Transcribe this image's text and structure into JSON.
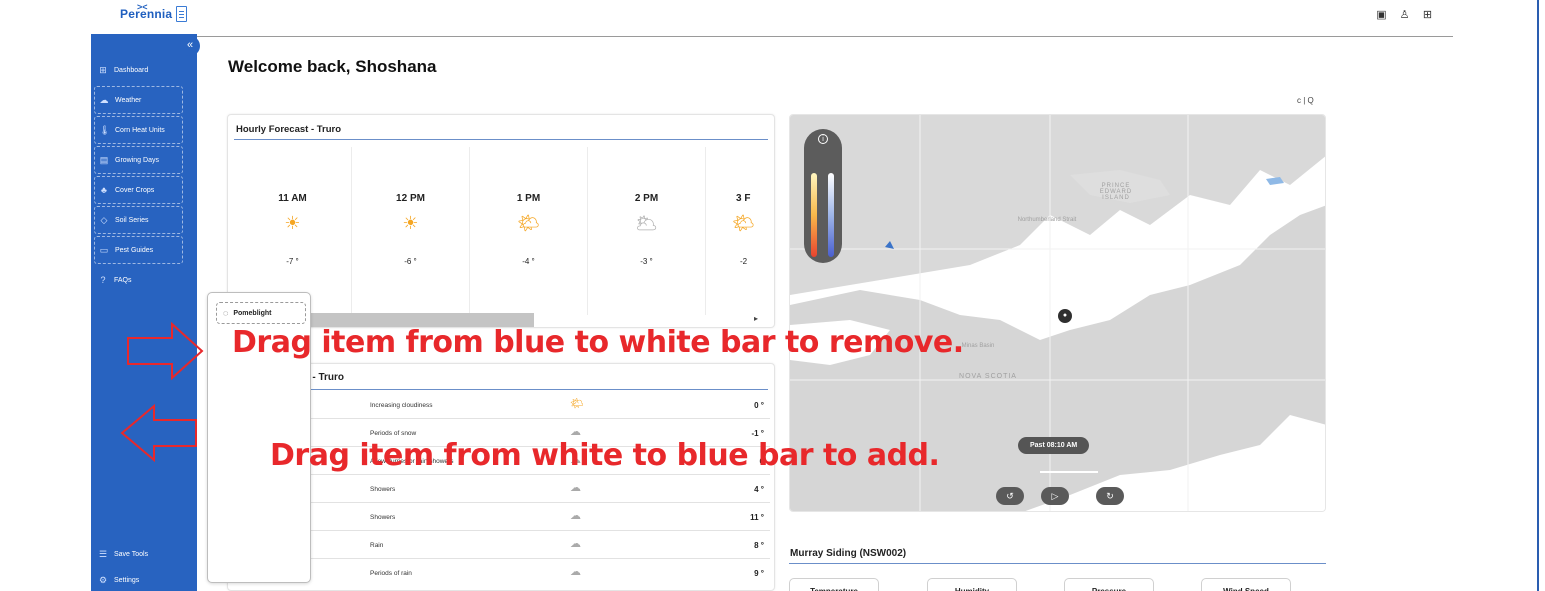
{
  "app": {
    "logo_text": "Perennia",
    "logo_mark": "><"
  },
  "header": {
    "icons": [
      "clipboard-icon",
      "user-icon",
      "grid-icon"
    ]
  },
  "sidebar": {
    "collapse_label": "«",
    "items": [
      {
        "label": "Dashboard",
        "icon": "dashboard-icon"
      },
      {
        "label": "Weather",
        "icon": "weather-icon"
      },
      {
        "label": "Corn Heat Units",
        "icon": "thermometer-icon"
      },
      {
        "label": "Growing Days",
        "icon": "calendar-icon"
      },
      {
        "label": "Cover Crops",
        "icon": "plant-icon"
      },
      {
        "label": "Soil Series",
        "icon": "soil-icon"
      },
      {
        "label": "Pest Guides",
        "icon": "book-icon"
      },
      {
        "label": "FAQs",
        "icon": "help-icon"
      }
    ],
    "bottom_items": [
      {
        "label": "Save Tools",
        "icon": "list-icon"
      },
      {
        "label": "Settings",
        "icon": "gear-icon"
      }
    ]
  },
  "main": {
    "welcome": "Welcome back, Shoshana",
    "map_tools": "c | Q"
  },
  "hourly": {
    "title": "Hourly Forecast - Truro",
    "hours": [
      {
        "time": "11 AM",
        "icon": "☀",
        "temp": "-7 °"
      },
      {
        "time": "12 PM",
        "icon": "☀",
        "temp": "-6 °"
      },
      {
        "time": "1 PM",
        "icon": "🌤",
        "temp": "-4 °"
      },
      {
        "time": "2 PM",
        "icon": "🌥",
        "temp": "-3 °"
      },
      {
        "time": "3 F",
        "icon": "🌤",
        "temp": "-2"
      }
    ],
    "scroll_arrow": "▸"
  },
  "daily": {
    "title": "ecast - Truro",
    "rows": [
      {
        "desc": "Increasing cloudiness",
        "icon": "🌤",
        "temp": "0 °"
      },
      {
        "desc": "Periods of snow",
        "icon": "☁",
        "temp": "-1 °"
      },
      {
        "desc": "A few flurries or rain showers",
        "icon": "☁",
        "temp": "6"
      },
      {
        "desc": "Showers",
        "icon": "☁",
        "temp": "4 °"
      },
      {
        "desc": "Showers",
        "icon": "☁",
        "temp": "11 °"
      },
      {
        "desc": "Rain",
        "icon": "☁",
        "temp": "8 °"
      },
      {
        "desc": "Periods of rain",
        "icon": "☁",
        "temp": "9 °"
      }
    ]
  },
  "map": {
    "info": "i",
    "labels": {
      "pei": "PRINCE EDWARD ISLAND",
      "strait": "Northumberland Strait",
      "basin": "Minas Basin",
      "ns": "NOVA SCOTIA"
    },
    "station_marker": "●",
    "time_label": "Past 08:10 AM",
    "controls": [
      "↺",
      "▷",
      "↻"
    ]
  },
  "station": {
    "title": "Murray Siding (NSW002)",
    "metrics": [
      "Temperature",
      "Humidity",
      "Pressure",
      "Wind Speed"
    ]
  },
  "drag_panel": {
    "item_label": "Pomeblight",
    "item_icon": "apple-icon"
  },
  "annotations": {
    "remove": "Drag item from blue to white bar to remove.",
    "add": "Drag item from white to blue bar to add."
  },
  "colors": {
    "sidebar": "#2863c0",
    "annotation": "#e8282b"
  }
}
